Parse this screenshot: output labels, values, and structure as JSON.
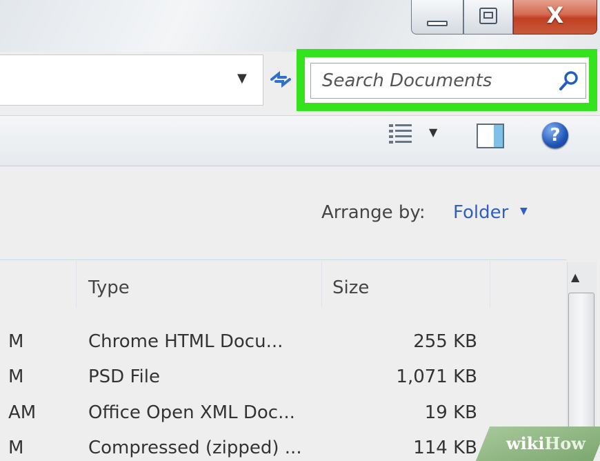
{
  "window": {
    "close_glyph": "X"
  },
  "search": {
    "placeholder": "Search Documents",
    "value": ""
  },
  "content": {
    "arrange_label": "Arrange by:",
    "arrange_value": "Folder"
  },
  "columns": {
    "type": "Type",
    "size": "Size"
  },
  "rows": [
    {
      "date_tail": "M",
      "type": "Chrome HTML Docu...",
      "size": "255 KB"
    },
    {
      "date_tail": "M",
      "type": "PSD File",
      "size": "1,071 KB"
    },
    {
      "date_tail": "AM",
      "type": "Office Open XML Doc...",
      "size": "19 KB"
    },
    {
      "date_tail": "M",
      "type": "Compressed (zipped) ...",
      "size": "114 KB"
    }
  ],
  "watermark": {
    "part1": "wiki",
    "part2": "How"
  },
  "colors": {
    "highlight": "#35e21e",
    "link": "#2f5fc4",
    "close_button": "#c13f22"
  },
  "icons": [
    "minimize-icon",
    "maximize-icon",
    "close-icon",
    "dropdown-arrow-icon",
    "refresh-icon",
    "search-icon",
    "views-icon",
    "preview-pane-icon",
    "help-icon",
    "scroll-up-icon"
  ]
}
